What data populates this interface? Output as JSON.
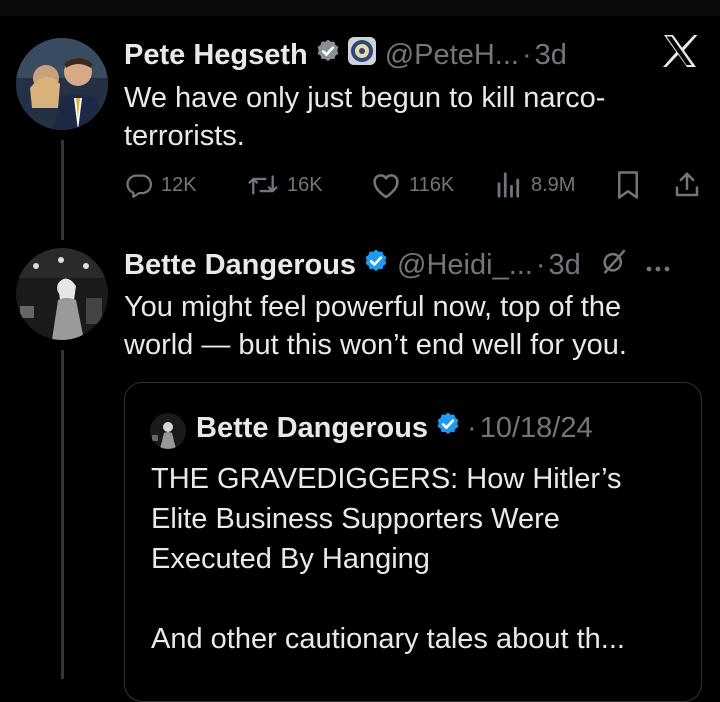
{
  "tweet": {
    "author_name": "Pete Hegseth",
    "handle": "@PeteH...",
    "separator": "·",
    "time": "3d",
    "text_line1": "We have only just begun to kill narco-",
    "text_line2": "terrorists.",
    "stats": {
      "replies": "12K",
      "reposts": "16K",
      "likes": "116K",
      "views": "8.9M"
    }
  },
  "reply": {
    "author_name": "Bette Dangerous",
    "handle": "@Heidi_...",
    "separator": "·",
    "time": "3d",
    "text_line1": "You might feel powerful now, top of the",
    "text_line2": "world — but this won’t end well for you.",
    "quote": {
      "author_name": "Bette Dangerous",
      "separator": "·",
      "date": "10/18/24",
      "line1": "THE GRAVEDIGGERS: How Hitler’s",
      "line2": "Elite Business Supporters Were",
      "line3": "Executed By Hanging",
      "line4": "And other cautionary tales about th..."
    }
  },
  "icons": {
    "verified": "verified-badge-icon",
    "affiliate": "government-seal-icon",
    "x_logo": "x-logo-icon",
    "reply": "reply-icon",
    "repost": "repost-icon",
    "like": "heart-icon",
    "views": "views-icon",
    "bookmark": "bookmark-icon",
    "share": "share-icon",
    "grok": "grok-icon",
    "more": "more-icon"
  },
  "colors": {
    "background": "#000000",
    "text": "#e7e9ea",
    "secondary": "#71767b",
    "verified_blue": "#1d9bf0",
    "border": "#2f3336"
  }
}
